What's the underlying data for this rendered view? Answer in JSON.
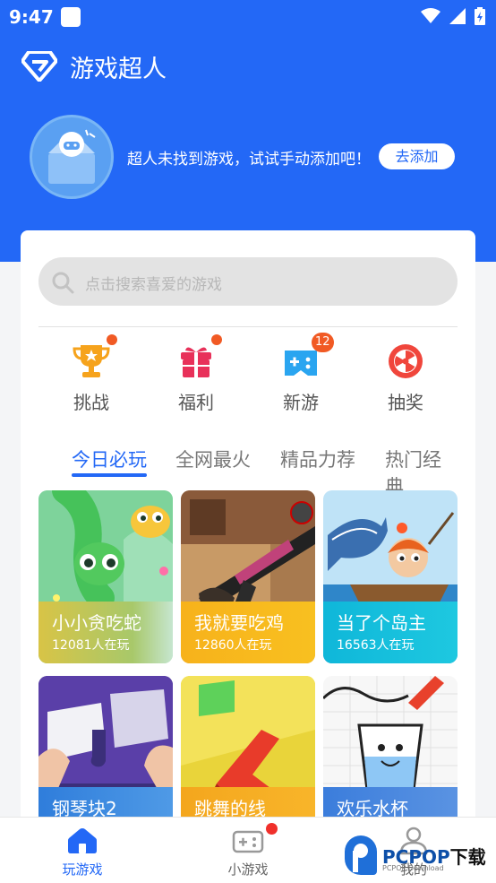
{
  "status": {
    "time": "9:47",
    "icons": [
      "notification-icon",
      "wifi-icon",
      "signal-icon",
      "battery-icon"
    ]
  },
  "app": {
    "title": "游戏超人",
    "logo": "superman-logo",
    "accent": "#2368f6"
  },
  "empty_state": {
    "message": "超人未找到游戏，试试手动添加吧！",
    "add_label": "去添加",
    "illustration": "mascot-box"
  },
  "search": {
    "placeholder": "点击搜索喜爱的游戏"
  },
  "shortcuts": [
    {
      "label": "挑战",
      "icon": "trophy-icon",
      "badge": "dot"
    },
    {
      "label": "福利",
      "icon": "gift-icon",
      "badge": "dot"
    },
    {
      "label": "新游",
      "icon": "gamepad-icon",
      "badge": "12"
    },
    {
      "label": "抽奖",
      "icon": "lottery-wheel-icon",
      "badge": ""
    }
  ],
  "tabs": [
    {
      "label": "今日必玩",
      "active": true
    },
    {
      "label": "全网最火",
      "active": false
    },
    {
      "label": "精品力荐",
      "active": false
    },
    {
      "label": "热门经典",
      "active": false
    }
  ],
  "games": [
    {
      "name": "小小贪吃蛇",
      "players": "12081人在玩",
      "art": "snake-game-art"
    },
    {
      "name": "我就要吃鸡",
      "players": "12860人在玩",
      "art": "shooter-game-art"
    },
    {
      "name": "当了个岛主",
      "players": "16563人在玩",
      "art": "island-fishing-art"
    },
    {
      "name": "钢琴块2",
      "players": "",
      "art": "piano-tiles-art"
    },
    {
      "name": "跳舞的线",
      "players": "",
      "art": "dancing-line-art"
    },
    {
      "name": "欢乐水杯",
      "players": "",
      "art": "happy-glass-art"
    }
  ],
  "bottom_nav": [
    {
      "label": "玩游戏",
      "icon": "home-icon",
      "active": true,
      "badge": false
    },
    {
      "label": "小游戏",
      "icon": "controller-icon",
      "active": false,
      "badge": true
    },
    {
      "label": "我的",
      "icon": "profile-icon",
      "active": false,
      "badge": false
    }
  ],
  "watermark": {
    "brand": "PCPOP",
    "brand_cn": "下载",
    "sub": "PCPOP Download"
  }
}
